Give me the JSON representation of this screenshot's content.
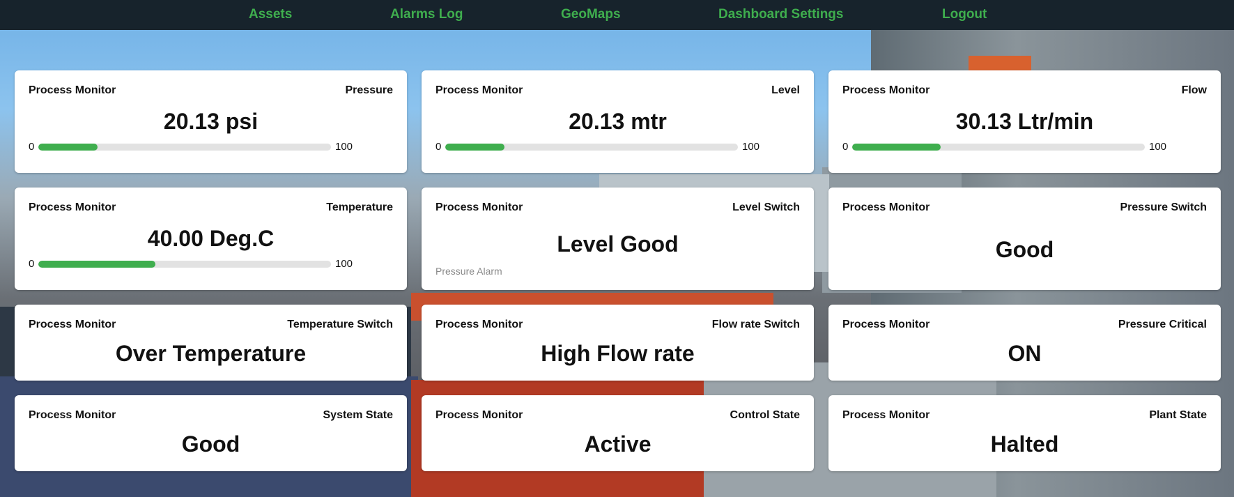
{
  "nav": {
    "items": [
      "Assets",
      "Alarms Log",
      "GeoMaps",
      "Dashboard Settings",
      "Logout"
    ]
  },
  "colors": {
    "accent": "#3fae4e",
    "nav_bg": "#17232c",
    "card_bg": "#ffffff"
  },
  "cards": [
    {
      "left": "Process Monitor",
      "right": "Pressure",
      "value": "20.13 psi",
      "min": "0",
      "max": "100",
      "level": 0.2013
    },
    {
      "left": "Process Monitor",
      "right": "Level",
      "value": "20.13 mtr",
      "min": "0",
      "max": "100",
      "level": 0.2013
    },
    {
      "left": "Process Monitor",
      "right": "Flow",
      "value": "30.13 Ltr/min",
      "min": "0",
      "max": "100",
      "level": 0.3013
    },
    {
      "left": "Process Monitor",
      "right": "Temperature",
      "value": "40.00 Deg.C",
      "min": "0",
      "max": "100",
      "level": 0.4
    },
    {
      "left": "Process Monitor",
      "right": "Level Switch",
      "value": "Level Good",
      "sub": "Pressure Alarm"
    },
    {
      "left": "Process Monitor",
      "right": "Pressure Switch",
      "value": "Good"
    },
    {
      "left": "Process Monitor",
      "right": "Temperature Switch",
      "value": "Over Temperature"
    },
    {
      "left": "Process Monitor",
      "right": "Flow rate Switch",
      "value": "High Flow rate"
    },
    {
      "left": "Process Monitor",
      "right": "Pressure Critical",
      "value": "ON"
    },
    {
      "left": "Process Monitor",
      "right": "System State",
      "value": "Good"
    },
    {
      "left": "Process Monitor",
      "right": "Control State",
      "value": "Active"
    },
    {
      "left": "Process Monitor",
      "right": "Plant State",
      "value": "Halted"
    }
  ]
}
